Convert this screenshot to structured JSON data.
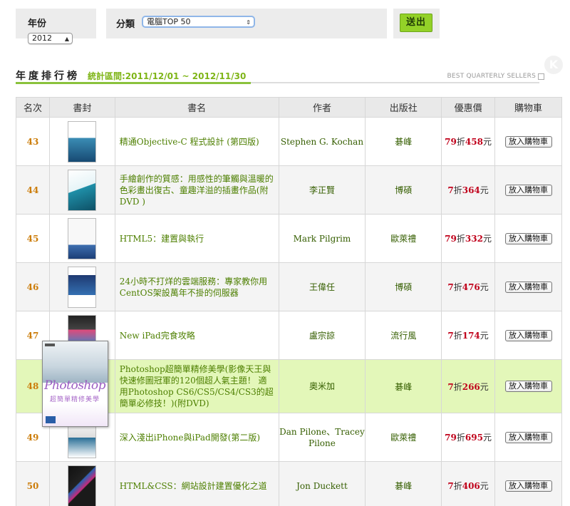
{
  "filter": {
    "year_label": "年份",
    "year_value": "2012",
    "category_label": "分類",
    "category_value": "電腦TOP 50",
    "submit_label": "送出"
  },
  "heading": {
    "title": "年度排行榜",
    "range": "統計區間:2011/12/01 ~ 2012/11/30",
    "best_sellers": "BEST QUARTERLY SELLERS"
  },
  "table": {
    "headers": [
      "名次",
      "書封",
      "書名",
      "作者",
      "出版社",
      "優惠價",
      "購物車"
    ],
    "cart_label": "放入購物車",
    "rows": [
      {
        "rank": "43",
        "title": "精通Objective-C 程式設計 (第四版)",
        "author": "Stephen G. Kochan",
        "publisher": "碁峰",
        "discount": "79",
        "zhe": "折",
        "price": "458",
        "unit": "元"
      },
      {
        "rank": "44",
        "title": "手繪創作的質感：用感性的筆觸與溫暖的色彩畫出復古、童趣洋溢的插畫作品(附DVD )",
        "author": "李正賢",
        "publisher": "博碩",
        "discount": "7",
        "zhe": "折",
        "price": "364",
        "unit": "元"
      },
      {
        "rank": "45",
        "title": "HTML5：建置與執行",
        "author": "Mark Pilgrim",
        "publisher": "歐萊禮",
        "discount": "79",
        "zhe": "折",
        "price": "332",
        "unit": "元"
      },
      {
        "rank": "46",
        "title": "24小時不打烊的雲端服務：專家教你用CentOS架設萬年不掛的伺服器",
        "author": "王偉任",
        "publisher": "博碩",
        "discount": "7",
        "zhe": "折",
        "price": "476",
        "unit": "元"
      },
      {
        "rank": "47",
        "title": "New iPad完食攻略",
        "author": "盧宗諒",
        "publisher": "流行風",
        "discount": "7",
        "zhe": "折",
        "price": "174",
        "unit": "元"
      },
      {
        "rank": "48",
        "title": "Photoshop超簡單精修美學(影像天王與快速修圖冠軍的120個超人氣主題！ 適用Photoshop CS6/CS5/CS4/CS3的超簡單必修技！)(附DVD)",
        "author": "奧米加",
        "publisher": "碁峰",
        "discount": "7",
        "zhe": "折",
        "price": "266",
        "unit": "元"
      },
      {
        "rank": "49",
        "title": "深入淺出iPhone與iPad開發(第二版)",
        "author": "Dan Pilone、Tracey Pilone",
        "publisher": "歐萊禮",
        "discount": "79",
        "zhe": "折",
        "price": "695",
        "unit": "元"
      },
      {
        "rank": "50",
        "title": "HTML&CSS：網站設計建置優化之道",
        "author": "Jon Duckett",
        "publisher": "碁峰",
        "discount": "7",
        "zhe": "折",
        "price": "406",
        "unit": "元"
      }
    ]
  },
  "popup": {
    "cover_word": "Photoshop",
    "cover_sub": "超簡單精修美學"
  },
  "colors": {
    "accent_green": "#8ac23c",
    "rank_orange": "#cc7d0a",
    "price_red": "#c0001a",
    "highlight_row": "#e3f7b9"
  }
}
